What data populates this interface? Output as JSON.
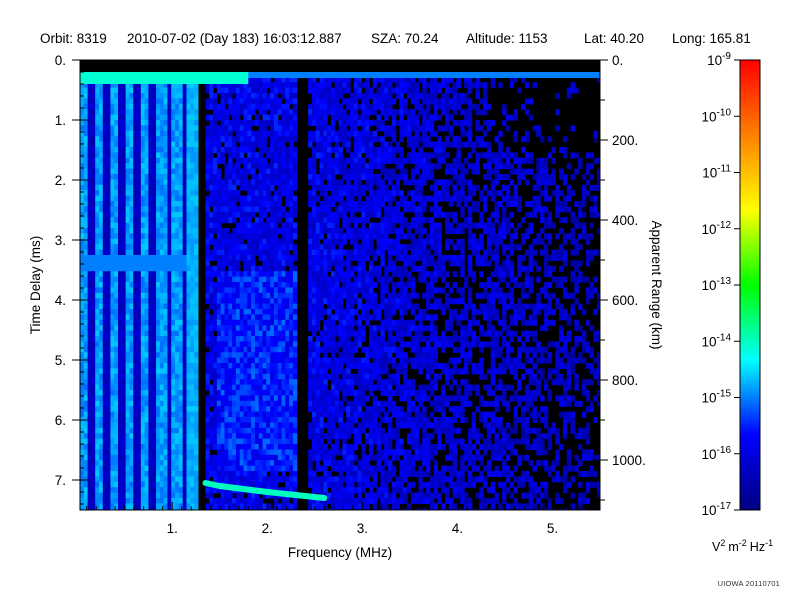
{
  "header": {
    "orbit": "Orbit: 8319",
    "datetime": "2010-07-02 (Day 183) 16:03:12.887",
    "sza": "SZA:  70.24",
    "altitude": "Altitude:     1153",
    "lat": "Lat:  40.20",
    "long": "Long: 165.81"
  },
  "footer": {
    "credit": "UIOWA 20110701"
  },
  "chart_data": {
    "type": "heatmap",
    "title": "",
    "xlabel": "Frequency (MHz)",
    "ylabel": "Time Delay (ms)",
    "y2label": "Apparent Range (km)",
    "xlim": [
      0.03,
      5.5
    ],
    "ylim": [
      7.5,
      0
    ],
    "y2lim": [
      1125,
      0
    ],
    "x_ticks": [
      1,
      2,
      3,
      4,
      5
    ],
    "x_tick_labels": [
      "1.",
      "2.",
      "3.",
      "4.",
      "5."
    ],
    "y_ticks": [
      0,
      1,
      2,
      3,
      4,
      5,
      6,
      7
    ],
    "y_tick_labels": [
      "0.",
      "1.",
      "2.",
      "3.",
      "4.",
      "5.",
      "6.",
      "7."
    ],
    "y2_ticks": [
      0,
      200,
      400,
      600,
      800,
      1000
    ],
    "y2_tick_labels": [
      "0.",
      "200.",
      "400.",
      "600.",
      "800.",
      "1000."
    ],
    "colorbar": {
      "label": "V 2 m -2 Hz -1",
      "scale": "log",
      "range": [
        1e-17,
        1e-09
      ],
      "tick_labels": [
        {
          "base": "10",
          "exp": "-9"
        },
        {
          "base": "10",
          "exp": "-10"
        },
        {
          "base": "10",
          "exp": "-11"
        },
        {
          "base": "10",
          "exp": "-12"
        },
        {
          "base": "10",
          "exp": "-13"
        },
        {
          "base": "10",
          "exp": "-14"
        },
        {
          "base": "10",
          "exp": "-15"
        },
        {
          "base": "10",
          "exp": "-16"
        },
        {
          "base": "10",
          "exp": "-17"
        }
      ],
      "colors": [
        "#000080",
        "#0000ff",
        "#00ffff",
        "#00ff00",
        "#ffff00",
        "#ff8000",
        "#ff0000"
      ]
    },
    "features": {
      "surface_reflection_band": {
        "delay_ms": 0.25,
        "x_range_mhz": [
          0.03,
          5.5
        ],
        "level": 1e-15
      },
      "ionospheric_echo_trace": {
        "x_mhz": [
          1.35,
          1.5,
          1.75,
          2.0,
          2.3,
          2.6
        ],
        "delay_ms": [
          7.05,
          7.1,
          7.15,
          7.2,
          7.25,
          7.3
        ],
        "level": 1e-14
      },
      "dark_lines_mhz": [
        1.3,
        2.35
      ],
      "background_level": 1e-16
    }
  }
}
